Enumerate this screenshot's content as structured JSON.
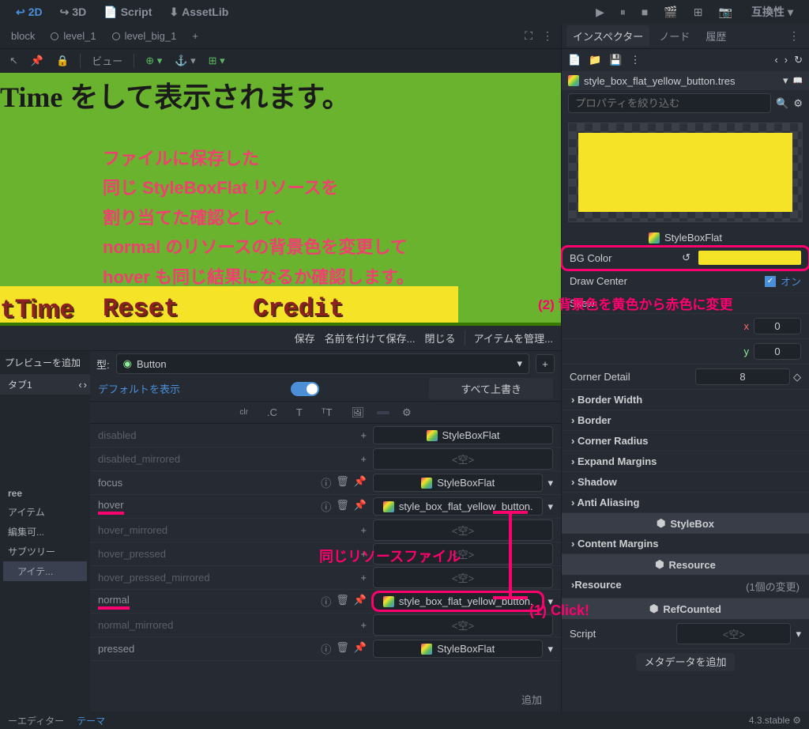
{
  "topbar": {
    "mode_2d": "2D",
    "mode_3d": "3D",
    "mode_script": "Script",
    "mode_assetlib": "AssetLib",
    "compat": "互換性"
  },
  "tabs": {
    "block": "block",
    "level_1": "level_1",
    "level_big_1": "level_big_1"
  },
  "toolbar": {
    "view": "ビュー"
  },
  "viewport": {
    "title_text": "Time をして表示されます。",
    "overlay_l1": "ファイルに保存した",
    "overlay_l2": "同じ StyleBoxFlat リソースを",
    "overlay_l3": "割り当てた確認として、",
    "overlay_l4": "normal のリソースの背景色を変更して",
    "overlay_l5": "hover も同じ結果になるか確認します。",
    "retro_time": "Time",
    "retro_reset": "Reset",
    "retro_credit": "Credit"
  },
  "theme_panel": {
    "save": "保存",
    "save_as": "名前を付けて保存...",
    "close": "閉じる",
    "manage": "アイテムを管理...",
    "add_preview": "プレビューを追加",
    "type_label": "型:",
    "type_value": "Button",
    "show_default": "デフォルトを表示",
    "overwrite_all": "すべて上書き",
    "icon_clr": "clr",
    "add_label": "追加",
    "annotation_same_file": "同じリソースファイル"
  },
  "tree": {
    "tab1": "タブ1",
    "header": "ree",
    "item_item": "アイテム",
    "item_edit": "編集可...",
    "item_subtree": "サブツリー",
    "item_nested": "アイテ..."
  },
  "props": [
    {
      "name": "disabled",
      "dim": true,
      "icons": false,
      "btype": "plus",
      "value": "StyleBoxFlat",
      "icon": true
    },
    {
      "name": "disabled_mirrored",
      "dim": true,
      "icons": false,
      "btype": "plus",
      "value": "<空>",
      "icon": false
    },
    {
      "name": "focus",
      "dim": false,
      "icons": true,
      "btype": "full",
      "value": "StyleBoxFlat",
      "icon": true,
      "chevron": true
    },
    {
      "name": "hover",
      "dim": false,
      "icons": true,
      "btype": "full",
      "value": "style_box_flat_yellow_button.",
      "icon": true,
      "chevron": true,
      "underline": true
    },
    {
      "name": "hover_mirrored",
      "dim": true,
      "icons": false,
      "btype": "plus",
      "value": "<空>",
      "icon": false
    },
    {
      "name": "hover_pressed",
      "dim": true,
      "icons": false,
      "btype": "plus",
      "value": "<空>",
      "icon": false
    },
    {
      "name": "hover_pressed_mirrored",
      "dim": true,
      "icons": false,
      "btype": "plus",
      "value": "<空>",
      "icon": false
    },
    {
      "name": "normal",
      "dim": false,
      "icons": true,
      "btype": "full",
      "value": "style_box_flat_yellow_button.",
      "icon": true,
      "chevron": true,
      "underline": true,
      "outline": true
    },
    {
      "name": "normal_mirrored",
      "dim": true,
      "icons": false,
      "btype": "plus",
      "value": "<空>",
      "icon": false
    },
    {
      "name": "pressed",
      "dim": false,
      "icons": true,
      "btype": "full",
      "value": "StyleBoxFlat",
      "icon": true,
      "chevron": true
    }
  ],
  "annotations": {
    "click": "(1) Click!",
    "change_bg": "(2) 背景色を黄色から赤色に変更"
  },
  "inspector": {
    "tab_inspector": "インスペクター",
    "tab_node": "ノード",
    "tab_history": "履歴",
    "resource_name": "style_box_flat_yellow_button.tres",
    "filter_placeholder": "プロパティを絞り込む",
    "preview_label": "StyleBoxFlat",
    "bg_color": "BG Color",
    "draw_center": "Draw Center",
    "draw_center_on": "オン",
    "skew": "Skew",
    "skew_x": "x",
    "skew_xv": "0",
    "skew_y": "y",
    "skew_yv": "0",
    "corner_detail": "Corner Detail",
    "corner_detail_v": "8",
    "border_width": "Border Width",
    "border": "Border",
    "corner_radius": "Corner Radius",
    "expand_margins": "Expand Margins",
    "shadow": "Shadow",
    "anti_aliasing": "Anti Aliasing",
    "sec_stylebox": "StyleBox",
    "content_margins": "Content Margins",
    "sec_resource": "Resource",
    "resource": "Resource",
    "resource_changes": "(1個の変更)",
    "sec_refcounted": "RefCounted",
    "script": "Script",
    "script_empty": "<空>",
    "add_metadata": "メタデータを追加"
  },
  "status": {
    "editor": "ーエディター",
    "theme": "テーマ",
    "version": "4.3.stable"
  }
}
